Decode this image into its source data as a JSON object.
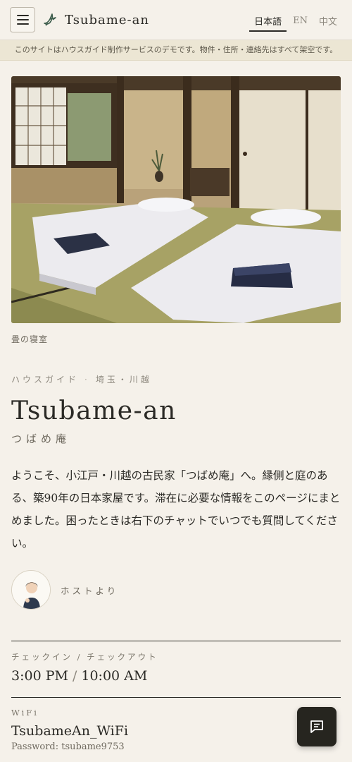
{
  "header": {
    "brand": "Tsubame-an",
    "languages": [
      "日本語",
      "EN",
      "中文"
    ],
    "active_language": "日本語"
  },
  "notice": "このサイトはハウスガイド制作サービスのデモです。物件・住所・連絡先はすべて架空です。",
  "hero": {
    "caption": "畳の寝室"
  },
  "guide": {
    "eyebrow_category": "ハウスガイド",
    "eyebrow_location": "埼玉・川越",
    "title": "Tsubame-an",
    "subtitle": "つばめ庵",
    "intro": "ようこそ、小江戸・川越の古民家「つばめ庵」へ。縁側と庭のある、築90年の日本家屋です。滞在に必要な情報をこのページにまとめました。困ったときは右下のチャットでいつでも質問してください。",
    "host_label": "ホストより"
  },
  "checkin": {
    "label": "チェックイン / チェックアウト",
    "checkin_time": "3:00 PM",
    "separator": "/",
    "checkout_time": "10:00 AM"
  },
  "wifi": {
    "label": "WiFi",
    "network": "TsubameAn_WiFi",
    "password_line": "Password: tsubame9753"
  },
  "icons": {
    "menu": "hamburger-icon",
    "logo": "swallow-icon",
    "chat": "chat-icon"
  },
  "colors": {
    "background": "#f5f1ea",
    "notice_bg": "#ece6d4",
    "text": "#2b2a26",
    "chat_button": "#26251f",
    "accent_green": "#3b5b4a"
  }
}
